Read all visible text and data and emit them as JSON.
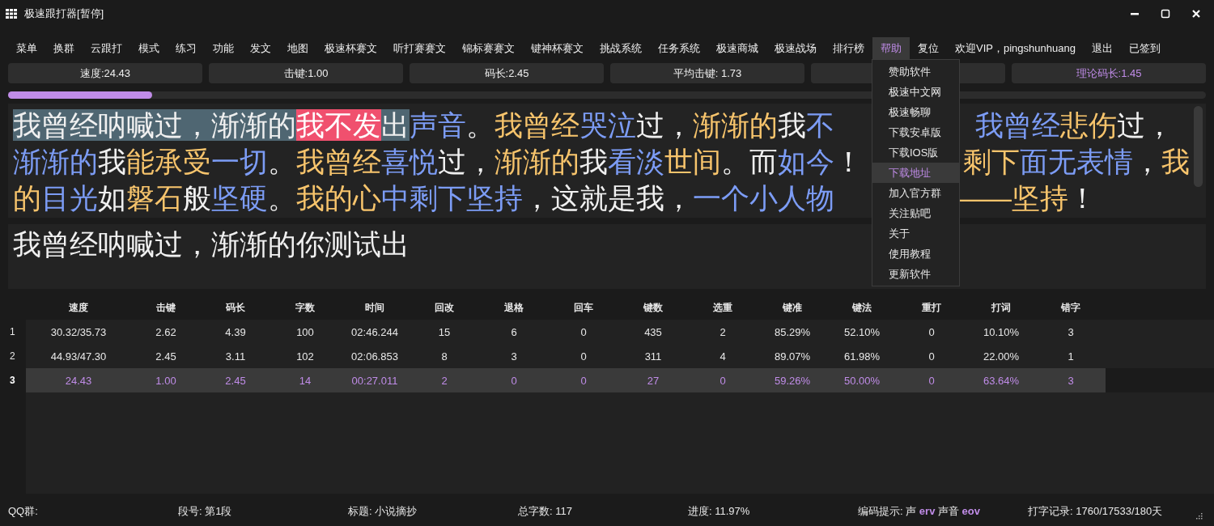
{
  "window": {
    "title": "极速跟打器[暂停]"
  },
  "menu": [
    {
      "label": "菜单",
      "selected": false
    },
    {
      "label": "换群",
      "selected": false
    },
    {
      "label": "云跟打",
      "selected": false
    },
    {
      "label": "模式",
      "selected": false
    },
    {
      "label": "练习",
      "selected": false
    },
    {
      "label": "功能",
      "selected": false
    },
    {
      "label": "发文",
      "selected": false
    },
    {
      "label": "地图",
      "selected": false
    },
    {
      "label": "极速杯赛文",
      "selected": false
    },
    {
      "label": "听打赛赛文",
      "selected": false
    },
    {
      "label": "锦标赛赛文",
      "selected": false
    },
    {
      "label": "键神杯赛文",
      "selected": false
    },
    {
      "label": "挑战系统",
      "selected": false
    },
    {
      "label": "任务系统",
      "selected": false
    },
    {
      "label": "极速商城",
      "selected": false
    },
    {
      "label": "极速战场",
      "selected": false
    },
    {
      "label": "排行榜",
      "selected": false
    },
    {
      "label": "帮助",
      "selected": true
    },
    {
      "label": "复位",
      "selected": false
    },
    {
      "label": "欢迎VIP，pingshunhuang",
      "selected": false
    },
    {
      "label": "退出",
      "selected": false
    },
    {
      "label": "已签到",
      "selected": false
    }
  ],
  "dropdown": [
    {
      "label": "赞助软件",
      "selected": false
    },
    {
      "label": "极速中文网",
      "selected": false
    },
    {
      "label": "极速畅聊",
      "selected": false
    },
    {
      "label": "下载安卓版",
      "selected": false
    },
    {
      "label": "下载IOS版",
      "selected": false
    },
    {
      "label": "下载地址",
      "selected": true
    },
    {
      "label": "加入官方群",
      "selected": false
    },
    {
      "label": "关注贴吧",
      "selected": false
    },
    {
      "label": "关于",
      "selected": false
    },
    {
      "label": "使用教程",
      "selected": false
    },
    {
      "label": "更新软件",
      "selected": false
    }
  ],
  "stats": [
    {
      "kind": "value",
      "label": "速度:24.43",
      "accent": false
    },
    {
      "kind": "value",
      "label": "击键:1.00",
      "accent": false
    },
    {
      "kind": "value",
      "label": "码长:2.45",
      "accent": false
    },
    {
      "kind": "value",
      "label": "平均击键: 1.73",
      "accent": false
    },
    {
      "kind": "blank"
    },
    {
      "kind": "value",
      "label": "理论码长:1.45",
      "accent": true
    }
  ],
  "progress": {
    "level": 0.12
  },
  "article": {
    "lines": [
      {
        "before": [
          {
            "text": "我曾经呐喊过，渐渐的",
            "kind": "typed"
          },
          {
            "text": "我不发",
            "kind": "error"
          },
          {
            "text": "出",
            "kind": "typed"
          },
          {
            "text": "声音",
            "kind": "plain",
            "color": "#7c9cf5"
          },
          {
            "text": "。",
            "kind": "plain",
            "color": "#f0f0f0"
          },
          {
            "text": "我曾经",
            "kind": "plain",
            "color": "#f7c46c"
          },
          {
            "text": "哭泣",
            "kind": "plain",
            "color": "#7c9cf5"
          },
          {
            "text": "过，",
            "kind": "plain",
            "color": "#f0f0f0"
          },
          {
            "text": "渐渐的",
            "kind": "plain",
            "color": "#f7c46c"
          },
          {
            "text": "我",
            "kind": "plain",
            "color": "#f0f0f0"
          },
          {
            "text": "不",
            "kind": "plain",
            "color": "#7c9cf5"
          }
        ],
        "after": [
          {
            "text": "我曾经",
            "kind": "plain",
            "color": "#7c9cf5"
          },
          {
            "text": "悲伤",
            "kind": "plain",
            "color": "#f7c46c"
          },
          {
            "text": "过，",
            "kind": "plain",
            "color": "#f0f0f0"
          }
        ]
      },
      {
        "before": [
          {
            "text": "渐渐的",
            "kind": "plain",
            "color": "#7c9cf5"
          },
          {
            "text": "我",
            "kind": "plain",
            "color": "#f0f0f0"
          },
          {
            "text": "能承受",
            "kind": "plain",
            "color": "#f7c46c"
          },
          {
            "text": "一切",
            "kind": "plain",
            "color": "#7c9cf5"
          },
          {
            "text": "。",
            "kind": "plain",
            "color": "#f0f0f0"
          },
          {
            "text": "我曾经",
            "kind": "plain",
            "color": "#f7c46c"
          },
          {
            "text": "喜悦",
            "kind": "plain",
            "color": "#7c9cf5"
          },
          {
            "text": "过，",
            "kind": "plain",
            "color": "#f0f0f0"
          },
          {
            "text": "渐渐的",
            "kind": "plain",
            "color": "#f7c46c"
          },
          {
            "text": "我",
            "kind": "plain",
            "color": "#f0f0f0"
          },
          {
            "text": "看淡",
            "kind": "plain",
            "color": "#7c9cf5"
          },
          {
            "text": "世间",
            "kind": "plain",
            "color": "#f7c46c"
          },
          {
            "text": "。而",
            "kind": "plain",
            "color": "#f0f0f0"
          },
          {
            "text": "如今",
            "kind": "plain",
            "color": "#7c9cf5"
          },
          {
            "text": "！",
            "kind": "plain",
            "color": "#f0f0f0"
          }
        ],
        "after": [
          {
            "text": "剩下",
            "kind": "plain",
            "color": "#f7c46c"
          },
          {
            "text": "面无表情",
            "kind": "plain",
            "color": "#7c9cf5"
          },
          {
            "text": "，",
            "kind": "plain",
            "color": "#f0f0f0"
          },
          {
            "text": "我",
            "kind": "plain",
            "color": "#f7c46c"
          }
        ]
      },
      {
        "before": [
          {
            "text": "的",
            "kind": "plain",
            "color": "#f7c46c"
          },
          {
            "text": "目光",
            "kind": "plain",
            "color": "#7c9cf5"
          },
          {
            "text": "如",
            "kind": "plain",
            "color": "#f0f0f0"
          },
          {
            "text": "磐石",
            "kind": "plain",
            "color": "#f7c46c"
          },
          {
            "text": "般",
            "kind": "plain",
            "color": "#f0f0f0"
          },
          {
            "text": "坚硬",
            "kind": "plain",
            "color": "#7c9cf5"
          },
          {
            "text": "。",
            "kind": "plain",
            "color": "#f0f0f0"
          },
          {
            "text": "我的心",
            "kind": "plain",
            "color": "#f7c46c"
          },
          {
            "text": "中剩下坚持",
            "kind": "plain",
            "color": "#7c9cf5"
          },
          {
            "text": "，这就是我，",
            "kind": "plain",
            "color": "#f0f0f0"
          },
          {
            "text": "一个小人物",
            "kind": "plain",
            "color": "#7c9cf5"
          }
        ],
        "after": [
          {
            "text": "——坚持",
            "kind": "plain",
            "color": "#f7c46c"
          },
          {
            "text": "！",
            "kind": "plain",
            "color": "#f0f0f0"
          }
        ]
      }
    ]
  },
  "input": {
    "value": "我曾经呐喊过，渐渐的你测试出"
  },
  "table": {
    "columns": [
      "速度",
      "击键",
      "码长",
      "字数",
      "时间",
      "回改",
      "退格",
      "回车",
      "键数",
      "选重",
      "键准",
      "键法",
      "重打",
      "打词",
      "错字"
    ],
    "rows": [
      {
        "index": "1",
        "selected": false,
        "cells": [
          "30.32/35.73",
          "2.62",
          "4.39",
          "100",
          "02:46.244",
          "15",
          "6",
          "0",
          "435",
          "2",
          "85.29%",
          "52.10%",
          "0",
          "10.10%",
          "3"
        ]
      },
      {
        "index": "2",
        "selected": false,
        "cells": [
          "44.93/47.30",
          "2.45",
          "3.11",
          "102",
          "02:06.853",
          "8",
          "3",
          "0",
          "311",
          "4",
          "89.07%",
          "61.98%",
          "0",
          "22.00%",
          "1"
        ]
      },
      {
        "index": "3",
        "selected": true,
        "cells": [
          "24.43",
          "1.00",
          "2.45",
          "14",
          "00:27.011",
          "2",
          "0",
          "0",
          "27",
          "0",
          "59.26%",
          "50.00%",
          "0",
          "63.64%",
          "3"
        ]
      }
    ]
  },
  "status_bar": [
    "QQ群:",
    "段号: 第1段",
    "标题: 小说摘抄",
    "总字数: 117",
    "进度: 11.97%",
    "编码提示: 声 **erv** 声音 **eov**",
    "打字记录: 1760/17533/180天"
  ]
}
